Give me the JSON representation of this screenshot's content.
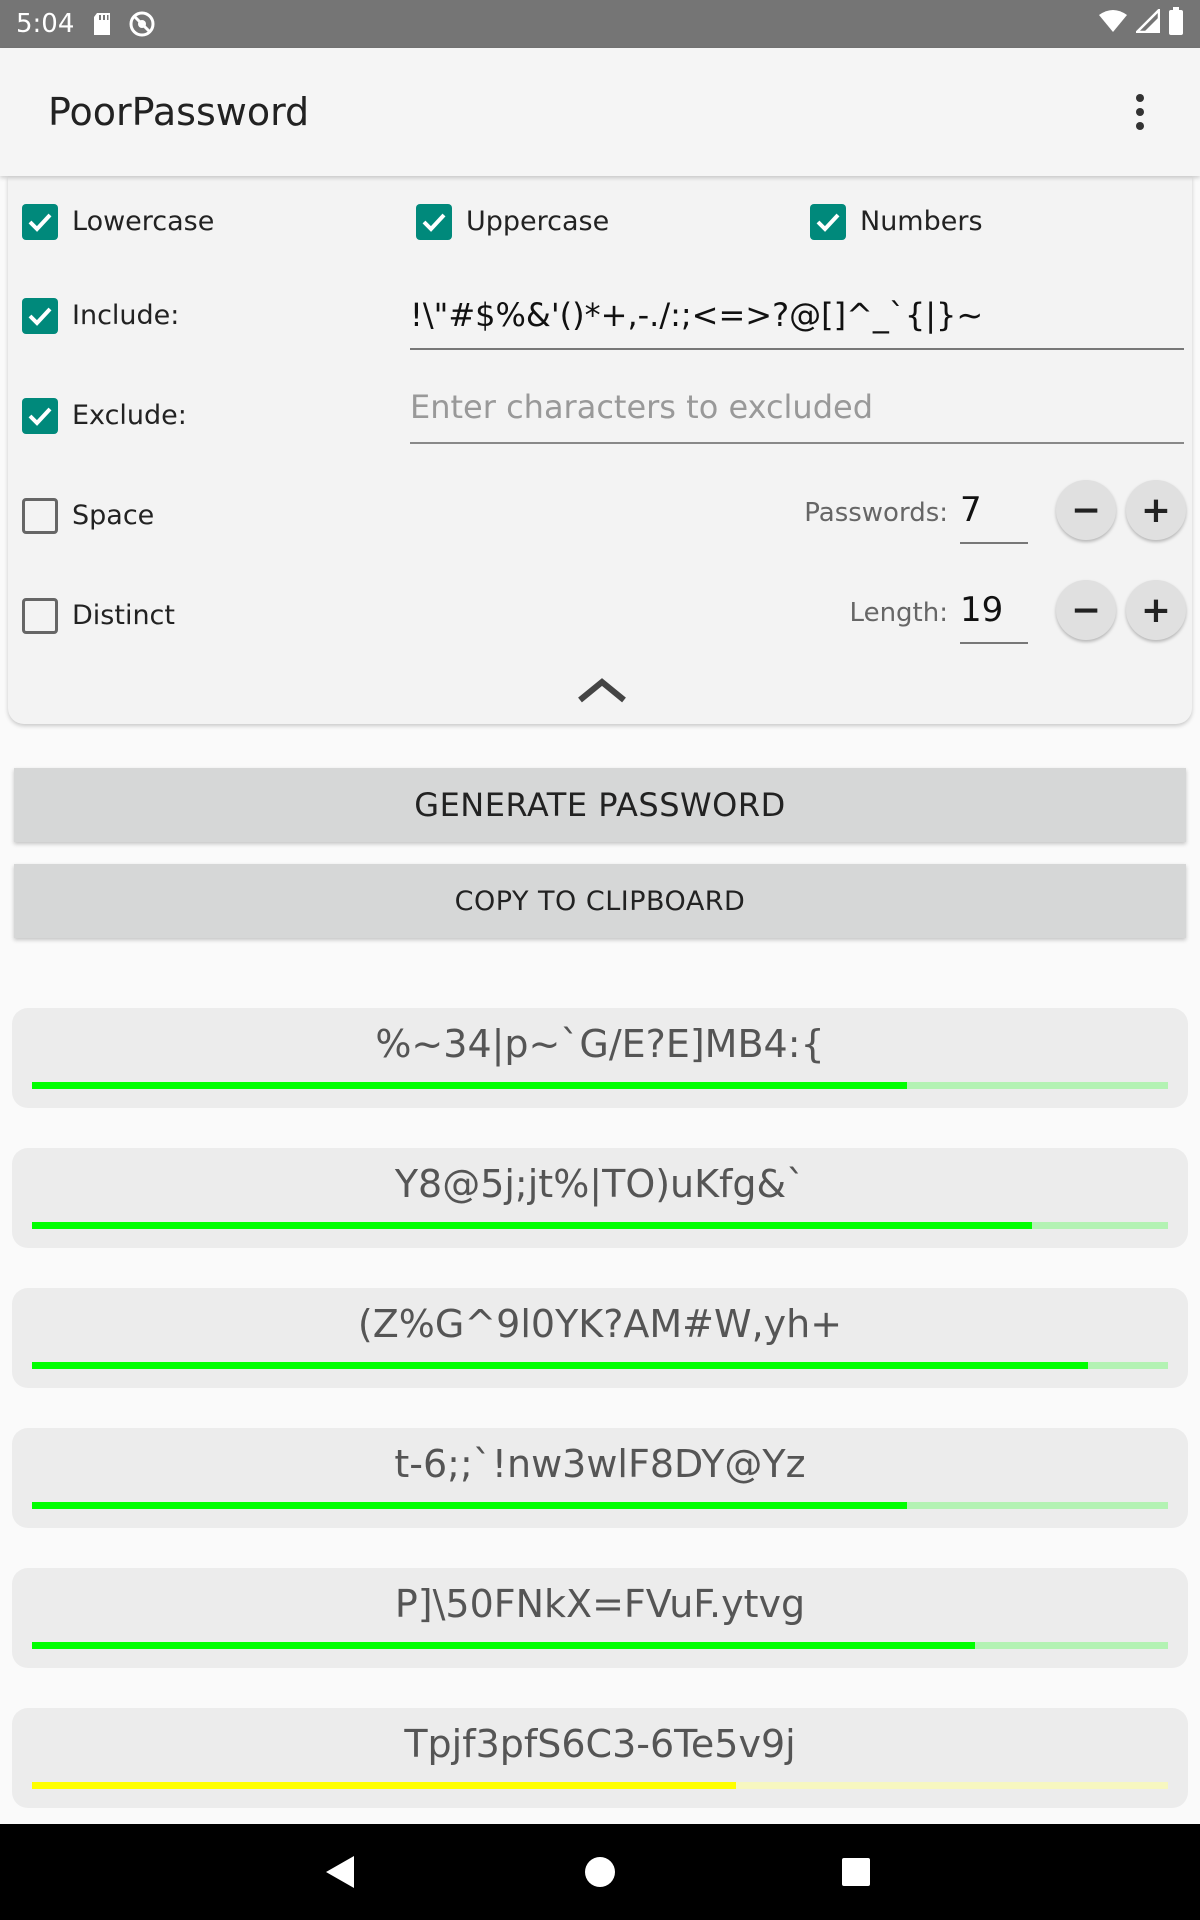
{
  "status_bar": {
    "time": "5:04",
    "icons": [
      "sd-card-icon",
      "sync-disabled-icon",
      "wifi-icon",
      "signal-icon",
      "battery-icon"
    ]
  },
  "app_bar": {
    "title": "PoorPassword",
    "overflow_icon": "more-vert-icon"
  },
  "options": {
    "lowercase": {
      "label": "Lowercase",
      "checked": true
    },
    "uppercase": {
      "label": "Uppercase",
      "checked": true
    },
    "numbers": {
      "label": "Numbers",
      "checked": true
    },
    "include": {
      "label": "Include:",
      "checked": true,
      "value": "!\\\"#$%&'()*+,-./:;<=>?@[]^_`{|}~"
    },
    "exclude": {
      "label": "Exclude:",
      "checked": true,
      "value": "",
      "placeholder": "Enter characters to excluded"
    },
    "space": {
      "label": "Space",
      "checked": false
    },
    "distinct": {
      "label": "Distinct",
      "checked": false
    },
    "passwords": {
      "label": "Passwords:",
      "value": "7",
      "minus": "−",
      "plus": "+"
    },
    "length": {
      "label": "Length:",
      "value": "19",
      "minus": "−",
      "plus": "+"
    },
    "collapse_icon": "chevron-up-icon"
  },
  "actions": {
    "generate": "GENERATE PASSWORD",
    "copy": "COPY TO CLIPBOARD"
  },
  "colors": {
    "accent": "#00897b",
    "strong": "#00ff00",
    "strong_track": "#b3f2b3",
    "medium": "#ffff00",
    "medium_track": "#f7f7c0"
  },
  "passwords": [
    {
      "text": "%~34|p~`G/E?E]MB4:{",
      "strength": 0.77,
      "level": "strong"
    },
    {
      "text": "Y8@5j;jt%|TO)uKfg&`",
      "strength": 0.88,
      "level": "strong"
    },
    {
      "text": "(Z%G^9l0YK?AM#W,yh+",
      "strength": 0.93,
      "level": "strong"
    },
    {
      "text": "t-6;;`!nw3wlF8DY@Yz",
      "strength": 0.77,
      "level": "strong"
    },
    {
      "text": "P]\\50FNkX=FVuF.ytvg",
      "strength": 0.83,
      "level": "strong"
    },
    {
      "text": "Tpjf3pfS6C3-6Te5v9j",
      "strength": 0.62,
      "level": "medium"
    }
  ]
}
